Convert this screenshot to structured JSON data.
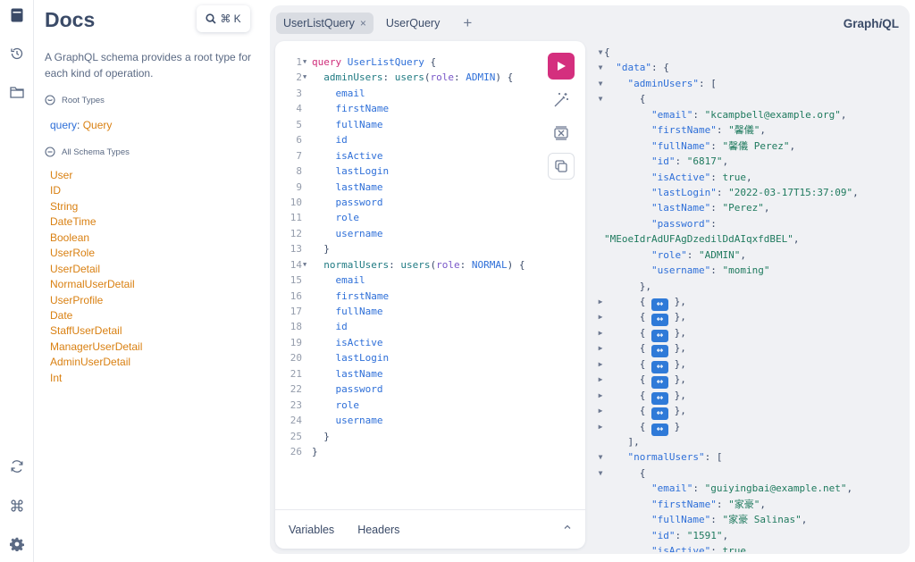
{
  "rail": {
    "top_icons": [
      "docs-icon",
      "history-icon",
      "explorer-icon"
    ],
    "bottom_icons": [
      "refetch-schema-icon",
      "shortcuts-icon",
      "settings-icon"
    ]
  },
  "docs": {
    "title": "Docs",
    "search_shortcut": "⌘ K",
    "description": "A GraphQL schema provides a root type for each kind of operation.",
    "root_types_heading": "Root Types",
    "root_key": "query",
    "root_sep": ":",
    "root_value": "Query",
    "all_types_heading": "All Schema Types",
    "types": [
      "User",
      "ID",
      "String",
      "DateTime",
      "Boolean",
      "UserRole",
      "UserDetail",
      "NormalUserDetail",
      "UserProfile",
      "Date",
      "StaffUserDetail",
      "ManagerUserDetail",
      "AdminUserDetail",
      "Int"
    ]
  },
  "tabs": [
    {
      "label": "UserListQuery",
      "active": true,
      "close": "×"
    },
    {
      "label": "UserQuery",
      "active": false
    }
  ],
  "add_tab": "+",
  "brand": {
    "prefix": "Graph",
    "italic": "i",
    "suffix": "QL"
  },
  "editor": {
    "line_numbers": [
      "1",
      "2",
      "3",
      "4",
      "5",
      "6",
      "7",
      "8",
      "9",
      "10",
      "11",
      "12",
      "13",
      "14",
      "15",
      "16",
      "17",
      "18",
      "19",
      "20",
      "21",
      "22",
      "23",
      "24",
      "25",
      "26"
    ],
    "keyword_query": "query",
    "operation_name": "UserListQuery",
    "open_brace": "{",
    "close_brace": "}",
    "admin_alias": "adminUsers",
    "normal_alias": "normalUsers",
    "colon": ":",
    "field_users": "users",
    "paren_open": "(",
    "paren_close": ")",
    "arg_name": "role",
    "admin_enum": "ADMIN",
    "normal_enum": "NORMAL",
    "fields": [
      "email",
      "firstName",
      "fullName",
      "id",
      "isActive",
      "lastLogin",
      "lastName",
      "password",
      "role",
      "username"
    ]
  },
  "editor_footer": {
    "variables_label": "Variables",
    "headers_label": "Headers"
  },
  "result": {
    "open_root": "{",
    "data_key": "\"data\"",
    "admin_key": "\"adminUsers\"",
    "normal_key": "\"normalUsers\"",
    "admin_first": {
      "email": "\"kcampbell@example.org\"",
      "firstName": "\"馨儀\"",
      "fullName": "\"馨儀 Perez\"",
      "id": "\"6817\"",
      "isActive": "true",
      "lastLogin": "\"2022-03-17T15:37:09\"",
      "lastName": "\"Perez\"",
      "password": "\"MEoeIdrAdUFAgDzedilDdAIqxfdBEL\"",
      "role": "\"ADMIN\"",
      "username": "\"moming\""
    },
    "collapsed_count": 9,
    "normal_first": {
      "email": "\"guiyingbai@example.net\"",
      "firstName": "\"家豪\"",
      "fullName": "\"家豪 Salinas\"",
      "id": "\"1591\"",
      "isActive": "true"
    },
    "keys": {
      "email": "\"email\"",
      "firstName": "\"firstName\"",
      "fullName": "\"fullName\"",
      "id": "\"id\"",
      "isActive": "\"isActive\"",
      "lastLogin": "\"lastLogin\"",
      "lastName": "\"lastName\"",
      "password": "\"password\"",
      "role": "\"role\"",
      "username": "\"username\""
    }
  }
}
